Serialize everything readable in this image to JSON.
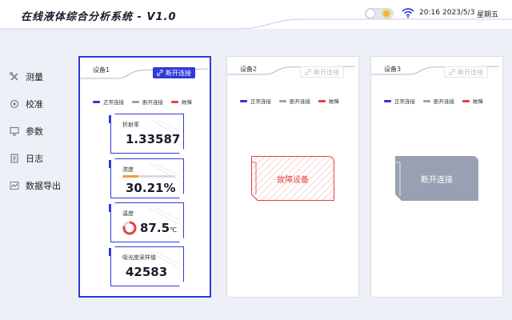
{
  "app": {
    "title": "在线液体综合分析系统  -  V1.0"
  },
  "status_bar": {
    "time": "20:16",
    "date": "2023/5/3",
    "weekday": "星期五",
    "theme_icon": "sun-icon",
    "wifi_icon": "wifi-icon"
  },
  "sidebar": {
    "items": [
      {
        "label": "测量",
        "icon": "tools-icon"
      },
      {
        "label": "校准",
        "icon": "target-icon"
      },
      {
        "label": "参数",
        "icon": "monitor-icon"
      },
      {
        "label": "日志",
        "icon": "document-icon"
      },
      {
        "label": "数据导出",
        "icon": "chart-icon"
      }
    ]
  },
  "legend": {
    "normal": "正常连接",
    "disconnected": "断开连接",
    "fault": "故障"
  },
  "colors": {
    "accent": "#2f3ad8",
    "normal": "#2f3ad8",
    "disconnected": "#9aa0b3",
    "fault": "#e64040",
    "warning": "#f0a13a"
  },
  "devices": [
    {
      "name": "设备1",
      "button_label": "断开连接",
      "status": "normal",
      "metrics": {
        "refractive_index": {
          "label": "折射率",
          "value": "1.33587"
        },
        "concentration": {
          "label": "浓度",
          "value": "30.21%",
          "progress": 0.3021
        },
        "temperature": {
          "label": "温度",
          "value": "87.5",
          "unit": "℃"
        },
        "absorbance": {
          "label": "吸光度采样值",
          "value": "42583"
        }
      }
    },
    {
      "name": "设备2",
      "button_label": "断开连接",
      "status": "fault",
      "state_text": "故障设备"
    },
    {
      "name": "设备3",
      "button_label": "断开连接",
      "status": "disconnected",
      "state_text": "断开连接"
    }
  ]
}
